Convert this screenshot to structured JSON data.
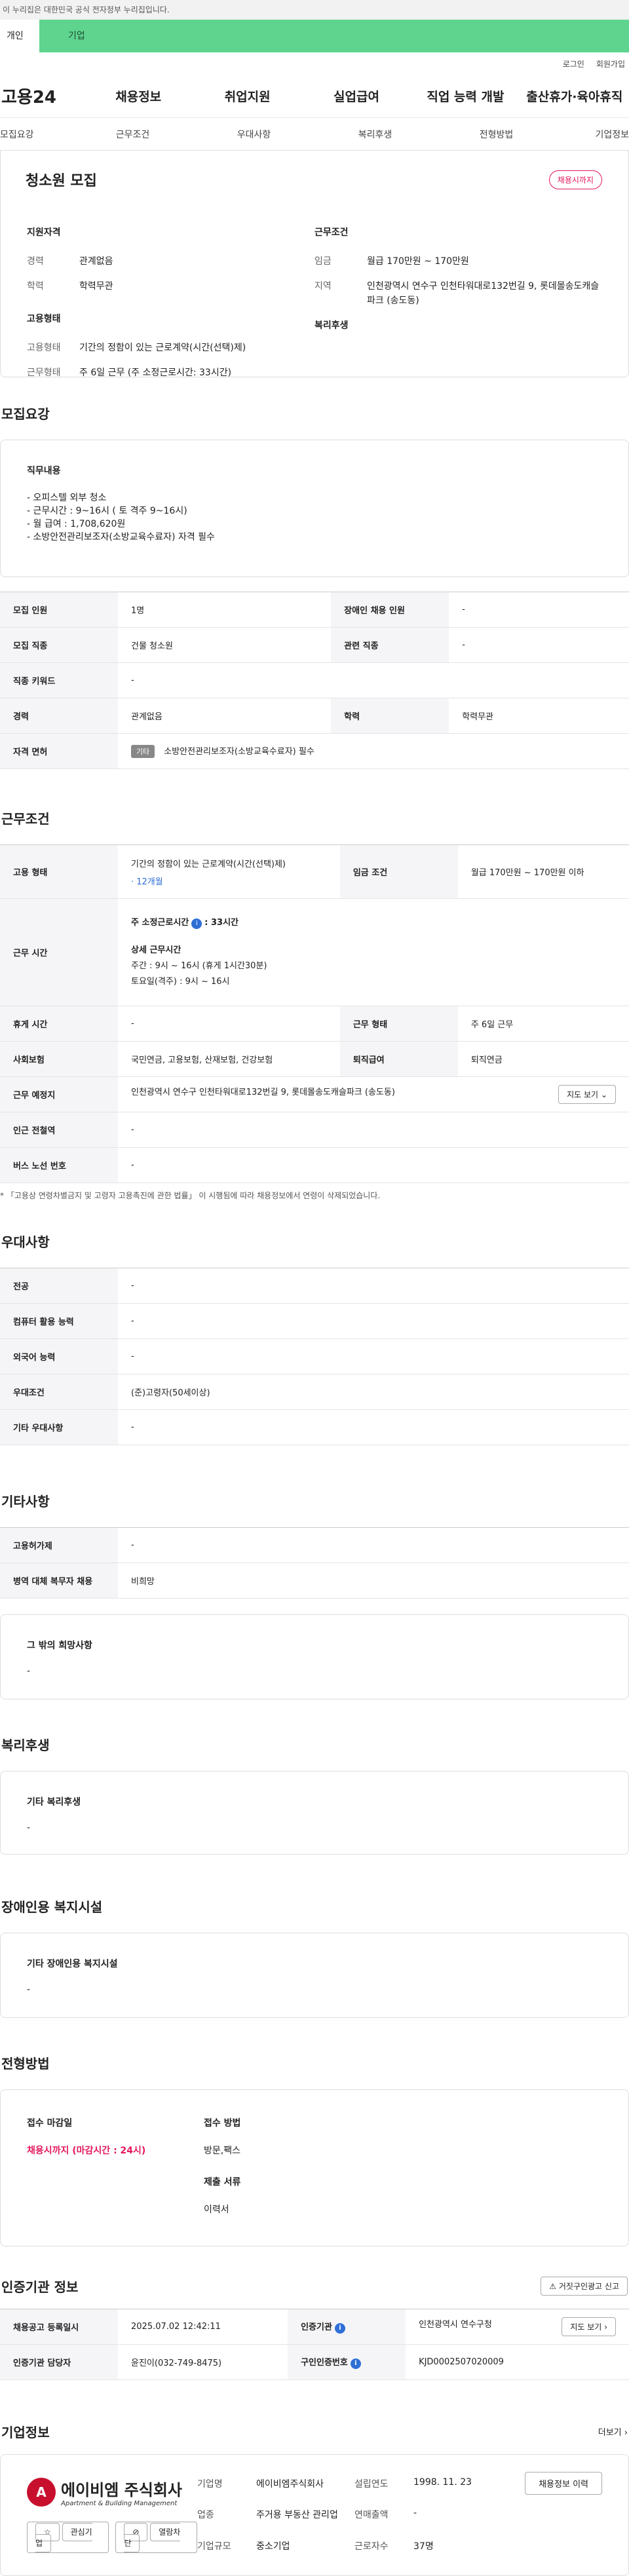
{
  "gov_banner": "이 누리집은 대한민국 공식 전자정부 누리집입니다.",
  "tabs": [
    "개인",
    "기업"
  ],
  "util": [
    "로그인",
    "회원가입"
  ],
  "logo": "고용24",
  "gnb": [
    "채용정보",
    "취업지원",
    "실업급여",
    "직업 능력 개발",
    "출산휴가·육아휴직"
  ],
  "anchor": [
    "모집요강",
    "근무조건",
    "우대사항",
    "복리후생",
    "전형방법",
    "기업정보"
  ],
  "summary": {
    "title": "청소원 모집",
    "badge": "채용시까지",
    "h1": "지원자격",
    "h2": "근무조건",
    "h3": "고용형태",
    "h4": "복리후생",
    "c1": [
      {
        "k": "경력",
        "v": "관계없음"
      },
      {
        "k": "학력",
        "v": "학력무관"
      }
    ],
    "c2": [
      {
        "k": "임금",
        "v": "월급 170만원 ~ 170만원"
      },
      {
        "k": "지역",
        "v": "인천광역시 연수구 인천타워대로132번길 9, 롯데몰송도캐슬파크 (송도동)"
      }
    ],
    "c3": [
      {
        "k": "고용형태",
        "v": "기간의 정함이 있는 근로계약(시간(선택)제)"
      },
      {
        "k": "근무형태",
        "v": "주 6일 근무 (주 소정근로시간: 33시간)"
      }
    ]
  },
  "s1": {
    "title": "모집요강",
    "dt": "직무내용",
    "lines": [
      "- 오피스텔 외부 청소",
      "- 근무시간 : 9~16시 ( 토 격주 9~16시)",
      "- 월 급여 : 1,708,620원",
      "- 소방안전관리보조자(소방교육수료자) 자격 필수"
    ],
    "rows": [
      [
        "모집 인원",
        "1명",
        "장애인 채용 인원",
        "-"
      ],
      [
        "모집 직종",
        "건물 청소원",
        "관련 직종",
        "-"
      ],
      [
        "직종 키워드",
        "-"
      ],
      [
        "경력",
        "관계없음",
        "학력",
        "학력무관"
      ]
    ],
    "lic_k": "자격 면허",
    "lic_tag": "기타",
    "lic_v": "소방안전관리보조자(소방교육수료자) 필수"
  },
  "s2": {
    "title": "근무조건",
    "emp_k": "고용 형태",
    "emp_v": "기간의 정함이 있는 근로계약(시간(선택)제)",
    "emp_p": "· 12개월",
    "wage_k": "임금 조건",
    "wage_v": "월급 170만원 ~ 170만원 이하",
    "time_k": "근무 시간",
    "time_h": "주 소정근로시간",
    "time_hv": ": 33시간",
    "time_d": "상세 근무시간",
    "time_l1": "주간 : 9시 ~ 16시 (휴게 1시간30분)",
    "time_l2": "토요일(격주) : 9시 ~ 16시",
    "rows": [
      [
        "휴게 시간",
        "-",
        "근무 형태",
        "주 6일 근무"
      ],
      [
        "사회보험",
        "국민연금, 고용보험, 산재보험, 건강보험",
        "퇴직급여",
        "퇴직연금"
      ]
    ],
    "place_k": "근무 예정지",
    "place_v": "인천광역시 연수구 인천타워대로132번길 9, 롯데몰송도캐슬파크 (송도동)",
    "map": "지도 보기",
    "r2": [
      [
        "인근 전철역",
        "-"
      ],
      [
        "버스 노선 번호",
        "-"
      ]
    ],
    "note": "* 「고용상 연령차별금지 및 고령자 고용촉진에 관한 법률」 이 시행됨에 따라 채용정보에서 연령이 삭제되었습니다."
  },
  "s3": {
    "title": "우대사항",
    "rows": [
      [
        "전공",
        "-"
      ],
      [
        "컴퓨터 활용 능력",
        "-"
      ],
      [
        "외국어 능력",
        "-"
      ],
      [
        "우대조건",
        "(준)고령자(50세이상)"
      ],
      [
        "기타 우대사항",
        "-"
      ]
    ]
  },
  "s4": {
    "title": "기타사항",
    "rows": [
      [
        "고용허가제",
        "-"
      ],
      [
        "병역 대체 복무자 채용",
        "비희망"
      ]
    ],
    "bt": "그 밖의 희망사항",
    "bv": "-"
  },
  "s5": {
    "title": "복리후생",
    "bt": "기타 복리후생",
    "bv": "-"
  },
  "s6": {
    "title": "장애인용 복지시설",
    "bt": "기타 장애인용 복지시설",
    "bv": "-"
  },
  "s7": {
    "title": "전형방법",
    "k1": "접수 마감일",
    "v1": "채용시까지 (마감시간 : 24시)",
    "k2": "접수 방법",
    "v2": "방문,팩스",
    "k3": "제출 서류",
    "v3": "이력서"
  },
  "s8": {
    "title": "인증기관 정보",
    "btn": "거짓구인광고 신고",
    "rows": [
      [
        "채용공고 등록일시",
        "2025.07.02 12:42:11",
        "인증기관",
        "인천광역시 연수구청"
      ],
      [
        "인증기관 담당자",
        "윤진이(032-749-8475)",
        "구인인증번호",
        "KJD0002507020009"
      ]
    ],
    "map": "지도 보기"
  },
  "s9": {
    "title": "기업정보",
    "more": "더보기",
    "logo": "에이비엠 주식회사",
    "logo_sub": "Apartment & Building Management",
    "logo_c": "A",
    "b1": "관심기업",
    "b2": "열람차단",
    "grid": [
      [
        "기업명",
        "에이비엠주식회사",
        "설립연도",
        "1998. 11. 23"
      ],
      [
        "업종",
        "주거용 부동산 관리업",
        "연매출액",
        "-"
      ],
      [
        "기업규모",
        "중소기업",
        "근로자수",
        "37명"
      ]
    ],
    "btn": "채용정보 이력"
  }
}
